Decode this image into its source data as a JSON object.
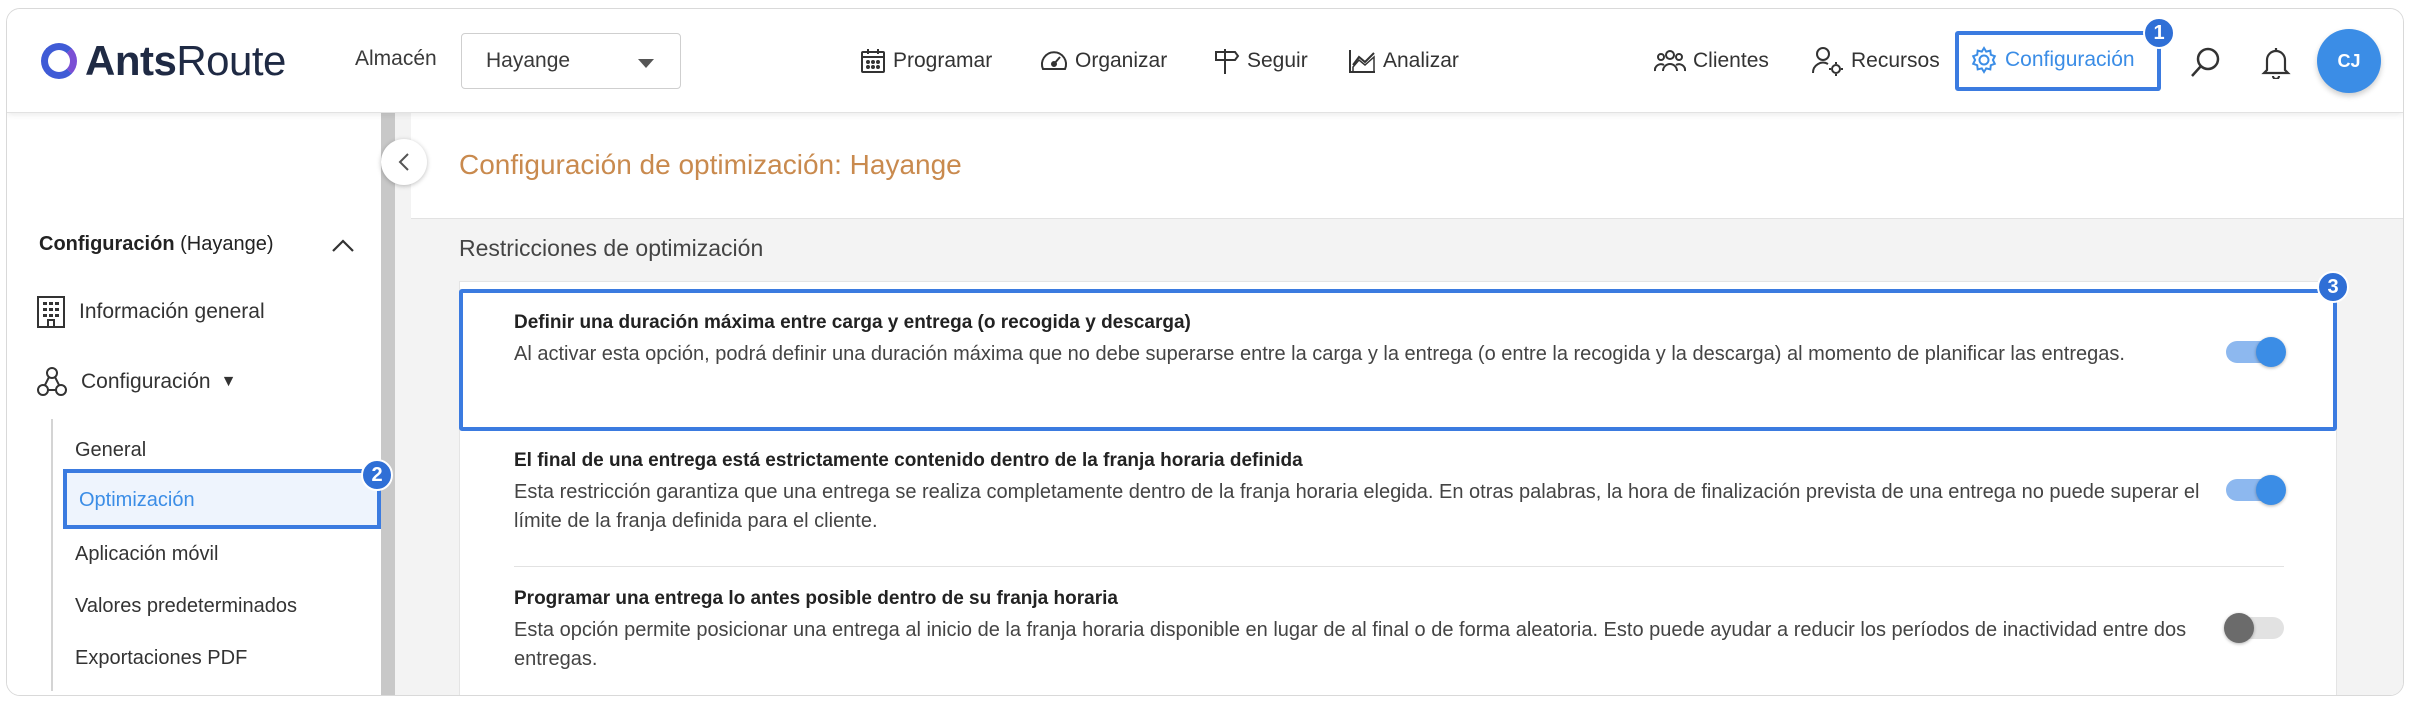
{
  "brand": {
    "name_bold": "Ants",
    "name_light": "Route"
  },
  "warehouse": {
    "label": "Almacén",
    "selected": "Hayange"
  },
  "nav": {
    "programar": "Programar",
    "organizar": "Organizar",
    "seguir": "Seguir",
    "analizar": "Analizar",
    "clientes": "Clientes",
    "recursos": "Recursos",
    "configuracion": "Configuración"
  },
  "user": {
    "initials": "CJ"
  },
  "badges": {
    "b1": "1",
    "b2": "2",
    "b3": "3"
  },
  "sidebar": {
    "header_bold": "Configuración",
    "header_rest": " (Hayange)",
    "items": {
      "info": "Información general",
      "config": "Configuración"
    },
    "sub": {
      "general": "General",
      "optimizacion": "Optimización",
      "movil": "Aplicación móvil",
      "valores": "Valores predeterminados",
      "pdf": "Exportaciones PDF"
    }
  },
  "page": {
    "title": "Configuración de optimización: Hayange",
    "section": "Restricciones de optimización"
  },
  "options": [
    {
      "title": "Definir una duración máxima entre carga y entrega (o recogida y descarga)",
      "desc": "Al activar esta opción, podrá definir una duración máxima que no debe superarse entre la carga y la entrega (o entre la recogida y la descarga) al momento de planificar las entregas.",
      "enabled": true
    },
    {
      "title": "El final de una entrega está estrictamente contenido dentro de la franja horaria definida",
      "desc": "Esta restricción garantiza que una entrega se realiza completamente dentro de la franja horaria elegida. En otras palabras, la hora de finalización prevista de una entrega no puede superar el límite de la franja definida para el cliente.",
      "enabled": true
    },
    {
      "title": "Programar una entrega lo antes posible dentro de su franja horaria",
      "desc": "Esta opción permite posicionar una entrega al inicio de la franja horaria disponible en lugar de al final o de forma aleatoria. Esto puede ayudar a reducir los períodos de inactividad entre dos entregas.",
      "enabled": false
    }
  ],
  "colors": {
    "accent": "#3b8de6",
    "highlight": "#3b7be0",
    "title_orange": "#c98a4e"
  }
}
